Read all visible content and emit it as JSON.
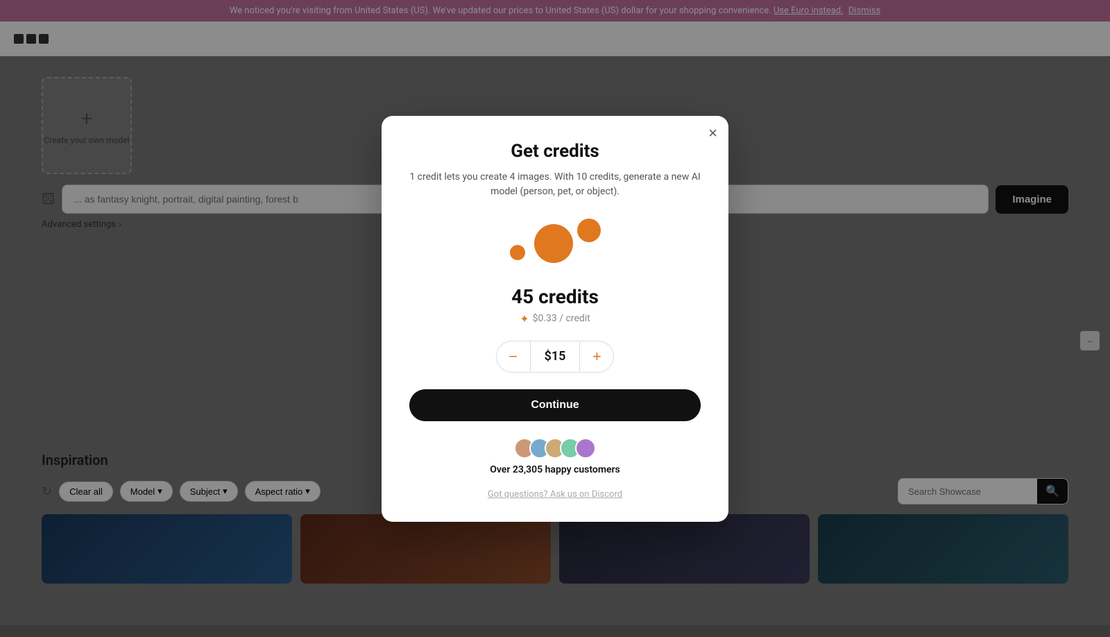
{
  "banner": {
    "text": "We noticed you're visiting from United States (US). We've updated our prices to United States (US) dollar for your shopping convenience.",
    "use_euro_label": "Use Euro instead.",
    "dismiss_label": "Dismiss"
  },
  "navbar": {
    "logo_squares": 3
  },
  "create_model_card": {
    "plus": "+",
    "label": "Create your own model"
  },
  "prompt": {
    "placeholder": "... as fantasy knight, portrait, digital painting, forest b",
    "imagine_label": "Imagine"
  },
  "advanced_settings": {
    "label": "Advanced settings",
    "chevron": "›"
  },
  "inspiration": {
    "title": "Inspiration",
    "clear_all": "Clear all",
    "model_label": "Model",
    "subject_label": "Subject",
    "aspect_ratio_label": "Aspect ratio",
    "search_placeholder": "Search Showcase"
  },
  "modal": {
    "title": "Get credits",
    "subtitle": "1 credit lets you create 4 images. With 10 credits, generate a new AI model (person, pet, or object).",
    "credits_amount": "45 credits",
    "price_per_credit": "$0.33 / credit",
    "price_value": "$15",
    "continue_label": "Continue",
    "social_proof_text": "Over 23,305 happy customers",
    "discord_link": "Got questions? Ask us on Discord",
    "close_label": "×"
  },
  "scroll_indicator": {
    "symbol": "↔"
  }
}
